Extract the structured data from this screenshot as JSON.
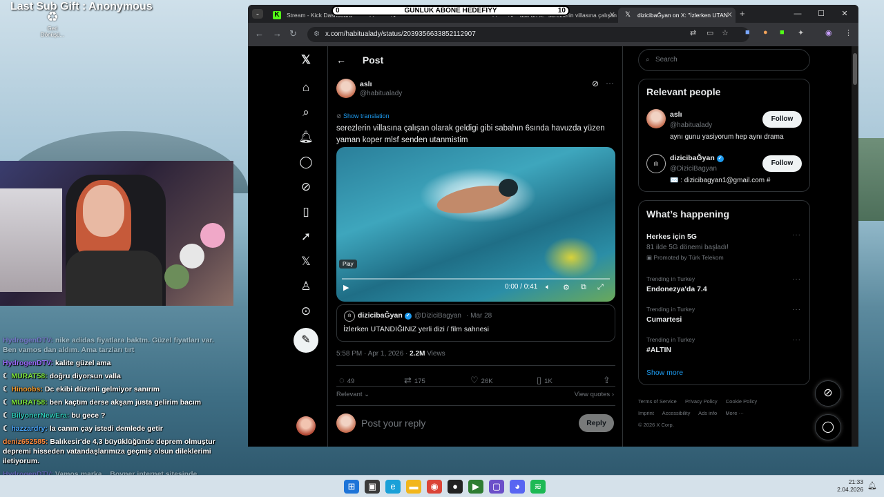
{
  "overlay": {
    "title": "Last Sub Gift : Anonymous",
    "goal_label": "GÜNLÜK ABONE HEDEFIYY",
    "goal_current": "0",
    "goal_target": "10"
  },
  "desktop": {
    "recycle_label": "Geri Dönüşü..."
  },
  "chat": [
    {
      "user": "HydrogenDTV:",
      "text": "nike adidas fiyatlara baktm. Güzel fiyatları var. Ben vamos dan aldım. Ama tarzları tırt",
      "color": "#9b6bff",
      "badge": false
    },
    {
      "user": "HydrogenDTV:",
      "text": "kalite güzel ama",
      "color": "#9b6bff",
      "badge": false
    },
    {
      "user": "MURAT58:",
      "text": "doğru diyorsun valla",
      "color": "#7be33b",
      "badge": true
    },
    {
      "user": "Hinoobs:",
      "text": "Dc ekibi düzenli gelmiyor sanırım",
      "color": "#f29a2e",
      "badge": true
    },
    {
      "user": "MURAT58:",
      "text": "ben kaçtım derse akşam justa gelirim bacım",
      "color": "#7be33b",
      "badge": true
    },
    {
      "user": "BilyonerNewEra:",
      "text": "bu gece ?",
      "color": "#2ec8b8",
      "badge": true
    },
    {
      "user": "hazzardry:",
      "text": "la canım çay istedi demlede getir",
      "color": "#4aa8ff",
      "badge": true
    },
    {
      "user": "deniz652585:",
      "text": "Balıkesir'de 4,3 büyüklüğünde deprem olmuştur depremi hisseden vatandaşlarımıza geçmiş olsun dileklerimi iletiyorum.",
      "color": "#ff8a3d",
      "badge": false
    },
    {
      "user": "HydrogenDTV:",
      "text": "Vamos marka... Boyner internet sitesinde buldum :)",
      "color": "#9b6bff",
      "badge": false
    }
  ],
  "browser": {
    "tabs": [
      {
        "title": "Stream - Kick Dashboard",
        "icon": "kick-icon"
      },
      {
        "title": "",
        "icon": "x-icon"
      },
      {
        "title": "aslı on X: \"serezlerin villasına çalışan",
        "icon": "x-icon"
      },
      {
        "title": "dizicibaǦyan on X: \"İzlerken UTAN",
        "icon": "x-icon"
      }
    ],
    "url": "x.com/habitualady/status/2039356633852112907"
  },
  "x": {
    "header": "Post",
    "author_name": "aslı",
    "author_handle": "@habitualady",
    "show_translation": "Show translation",
    "tweet_text": "serezlerin villasına çalışan olarak geldigi gibi sabahın 6sında havuzda yüzen yaman koper mlsf senden utanmistim",
    "video_tooltip": "Play",
    "video_time": "0:00 / 0:41",
    "quote_name": "dizicibaǦyan",
    "quote_handle": "@DiziciBagyan",
    "quote_date": "· Mar 28",
    "quote_text": "İzlerken UTANDIĞINIZ yerli dizi / film  sahnesi",
    "timestamp": "5:58 PM · Apr 1, 2026 · ",
    "views_count": "2.2M",
    "views_label": "Views",
    "replies": "49",
    "reposts": "175",
    "likes": "26K",
    "bookmarks": "1K",
    "relevant": "Relevant",
    "view_quotes": "View quotes",
    "reply_placeholder": "Post your reply",
    "reply_button": "Reply"
  },
  "sidebar": {
    "search_placeholder": "Search",
    "relevant_title": "Relevant people",
    "people": [
      {
        "name": "aslı",
        "handle": "@habitualady",
        "bio": "aynı gunu yasiyorum hep aynı drama",
        "button": "Follow"
      },
      {
        "name": "dizicibaǦyan",
        "handle": "@DiziciBagyan",
        "bio": "✉️ : dizicibagyan1@gmail.com #",
        "button": "Follow"
      }
    ],
    "happening_title": "What’s happening",
    "trends": [
      {
        "small": "",
        "big": "Herkes için 5G",
        "extra": "81 ilde 5G dönemi başladı!",
        "promo": "Promoted by Türk Telekom"
      },
      {
        "small": "Trending in Turkey",
        "big": "Endonezya'da 7.4"
      },
      {
        "small": "Trending in Turkey",
        "big": "Cumartesi"
      },
      {
        "small": "Trending in Turkey",
        "big": "#ALTIN"
      }
    ],
    "show_more": "Show more",
    "footer": [
      "Terms of Service",
      "Privacy Policy",
      "Cookie Policy",
      "Imprint",
      "Accessibility",
      "Ads info",
      "More ···",
      "© 2026 X Corp."
    ]
  },
  "taskbar": {
    "time": "21:33",
    "date": "2.04.2026"
  }
}
